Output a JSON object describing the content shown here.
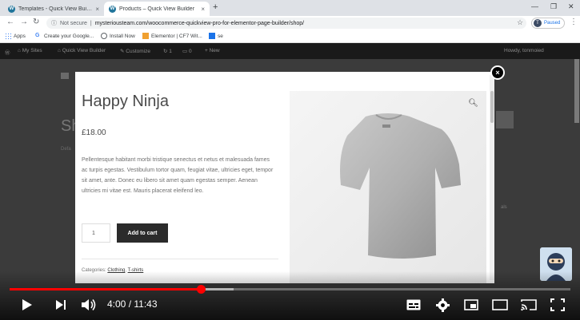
{
  "browser": {
    "tabs": [
      {
        "title": "Templates - Quick View Builder ...",
        "close": "×"
      },
      {
        "title": "Products – Quick View Builder",
        "close": "×"
      }
    ],
    "new_tab": "+",
    "address": {
      "security": "Not secure",
      "url": "mysteriousteam.com/woocommerce-quickview-pro-for-elementor-page-builder/shop/"
    },
    "profile": {
      "initial": "T",
      "status": "Paused"
    },
    "bookmarks": [
      "Apps",
      "Create your Google...",
      "Install Now",
      "Elementor | CF7 Wit...",
      "se"
    ]
  },
  "adminbar": {
    "items": [
      "My Sites",
      "Quick View Builder",
      "Customize",
      "1",
      "0",
      "New"
    ],
    "howdy": "Howdy, tonmoied"
  },
  "background": {
    "title_fragment": "Sh",
    "label_fragment": "Defa",
    "right_snippet": "als"
  },
  "modal": {
    "title": "Happy Ninja",
    "price": "£18.00",
    "description": "Pellentesque habitant morbi tristique senectus et netus et malesuada fames ac turpis egestas. Vestibulum tortor quam, feugiat vitae, ultricies eget, tempor sit amet, ante. Donec eu libero sit amet quam egestas semper. Aenean ultricies mi vitae est. Mauris placerat eleifend leo.",
    "quantity": "1",
    "add_to_cart": "Add to cart",
    "categories_label": "Categories:",
    "categories": [
      "Clothing",
      "T-shirts"
    ],
    "close": "×"
  },
  "player": {
    "time": "4:00 / 11:43",
    "progress_fraction": 0.341,
    "buffered_fraction": 0.4,
    "accent": "#ff0000"
  },
  "colors": {
    "modal_bg": "#ffffff",
    "overlay": "#3b3b3b",
    "button_dark": "#2b2b2b"
  }
}
